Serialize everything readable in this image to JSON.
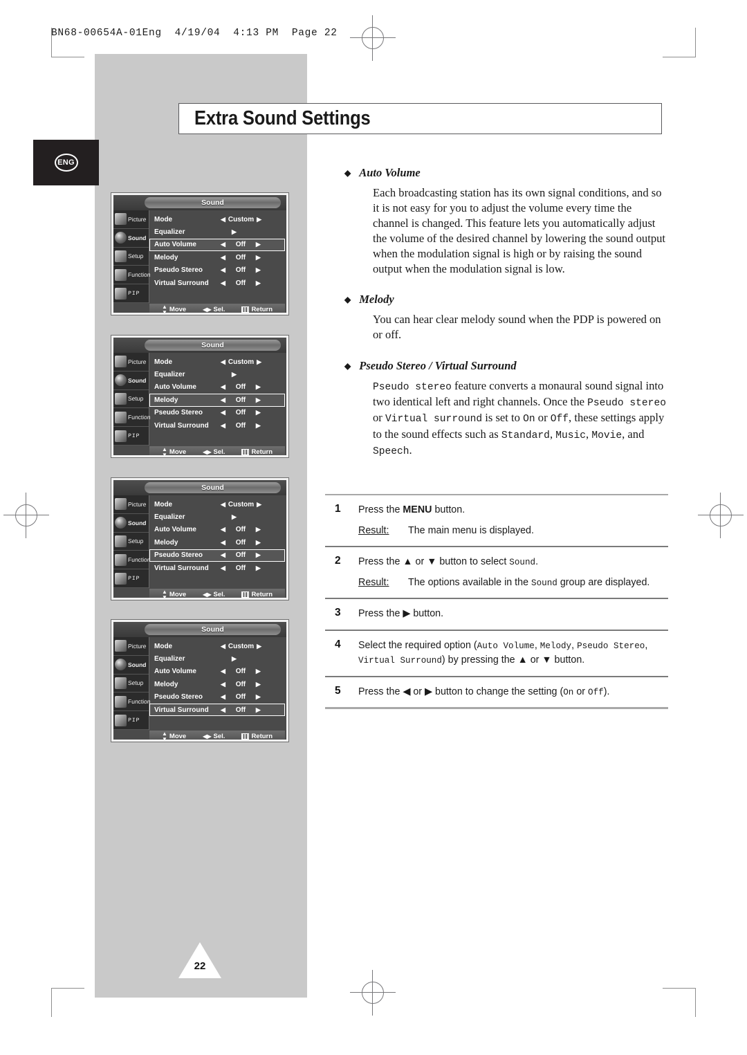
{
  "print_header": "BN68-00654A-01Eng  4/19/04  4:13 PM  Page 22",
  "language_badge": "ENG",
  "page_title": "Extra Sound Settings",
  "page_number": "22",
  "osd": {
    "title": "Sound",
    "sidebar": [
      {
        "label": "Picture",
        "icon": "picture-icon"
      },
      {
        "label": "Sound",
        "icon": "sound-icon"
      },
      {
        "label": "Setup",
        "icon": "setup-icon"
      },
      {
        "label": "Function",
        "icon": "function-icon"
      },
      {
        "label": "PIP",
        "icon": "pip-icon"
      }
    ],
    "rows": [
      {
        "label": "Mode",
        "value": "Custom",
        "arrows": "both"
      },
      {
        "label": "Equalizer",
        "value": "",
        "arrows": "right"
      },
      {
        "label": "Auto Volume",
        "value": "Off",
        "arrows": "both"
      },
      {
        "label": "Melody",
        "value": "Off",
        "arrows": "both"
      },
      {
        "label": "Pseudo Stereo",
        "value": "Off",
        "arrows": "both"
      },
      {
        "label": "Virtual Surround",
        "value": "Off",
        "arrows": "both"
      }
    ],
    "footer": [
      {
        "icon": "up-down-arrows-icon",
        "label": "Move"
      },
      {
        "icon": "left-right-arrows-icon",
        "label": "Sel."
      },
      {
        "icon": "menu-bars-icon",
        "label": "Return"
      }
    ],
    "screens": [
      {
        "highlight": "Auto Volume"
      },
      {
        "highlight": "Melody"
      },
      {
        "highlight": "Pseudo Stereo"
      },
      {
        "highlight": "Virtual Surround"
      }
    ]
  },
  "sections": [
    {
      "heading": "Auto Volume",
      "body": "Each broadcasting station has its own signal conditions, and so it is not easy for you to adjust the volume every time the channel is changed. This feature lets you automatically adjust the volume of the desired channel by lowering the sound output when the modulation signal is high or by raising the sound output when the modulation signal is low."
    },
    {
      "heading": "Melody",
      "body": "You can hear clear melody sound when the PDP is powered on or off."
    },
    {
      "heading": "Pseudo Stereo / Virtual Surround",
      "body_parts": [
        {
          "t": "Pseudo stereo",
          "m": true
        },
        {
          "t": " feature converts a monaural sound signal into two identical left and right channels. Once the ",
          "m": false
        },
        {
          "t": "Pseudo stereo",
          "m": true
        },
        {
          "t": " or ",
          "m": false
        },
        {
          "t": "Virtual surround",
          "m": true
        },
        {
          "t": " is set to ",
          "m": false
        },
        {
          "t": "On",
          "m": true
        },
        {
          "t": " or ",
          "m": false
        },
        {
          "t": "Off",
          "m": true
        },
        {
          "t": ", these settings apply to the sound effects such as ",
          "m": false
        },
        {
          "t": "Standard",
          "m": true
        },
        {
          "t": ", ",
          "m": false
        },
        {
          "t": "Music",
          "m": true
        },
        {
          "t": ", ",
          "m": false
        },
        {
          "t": "Movie",
          "m": true
        },
        {
          "t": ", and ",
          "m": false
        },
        {
          "t": "Speech",
          "m": true
        },
        {
          "t": ".",
          "m": false
        }
      ]
    }
  ],
  "steps": [
    {
      "num": "1",
      "parts": [
        {
          "t": "Press the ",
          "s": "n"
        },
        {
          "t": "MENU",
          "s": "b"
        },
        {
          "t": " button.",
          "s": "n"
        }
      ],
      "result_label": "Result:",
      "result_parts": [
        {
          "t": "The main menu is displayed.",
          "s": "n"
        }
      ]
    },
    {
      "num": "2",
      "parts": [
        {
          "t": "Press the ",
          "s": "n"
        },
        {
          "t": "▲",
          "s": "n"
        },
        {
          "t": " or ",
          "s": "n"
        },
        {
          "t": "▼",
          "s": "n"
        },
        {
          "t": " button to select ",
          "s": "n"
        },
        {
          "t": "Sound",
          "s": "m"
        },
        {
          "t": ".",
          "s": "n"
        }
      ],
      "result_label": "Result:",
      "result_parts": [
        {
          "t": "The options available in the ",
          "s": "n"
        },
        {
          "t": "Sound",
          "s": "m"
        },
        {
          "t": " group are displayed.",
          "s": "n"
        }
      ]
    },
    {
      "num": "3",
      "parts": [
        {
          "t": "Press the ",
          "s": "n"
        },
        {
          "t": "▶",
          "s": "n"
        },
        {
          "t": " button.",
          "s": "n"
        }
      ],
      "result_label": "",
      "result_parts": []
    },
    {
      "num": "4",
      "parts": [
        {
          "t": "Select the required option (",
          "s": "n"
        },
        {
          "t": "Auto Volume",
          "s": "m"
        },
        {
          "t": ", ",
          "s": "n"
        },
        {
          "t": "Melody",
          "s": "m"
        },
        {
          "t": ", ",
          "s": "n"
        },
        {
          "t": "Pseudo Stereo",
          "s": "m"
        },
        {
          "t": ", ",
          "s": "n"
        },
        {
          "t": "Virtual Surround",
          "s": "m"
        },
        {
          "t": ") by pressing the ",
          "s": "n"
        },
        {
          "t": "▲",
          "s": "n"
        },
        {
          "t": " or ",
          "s": "n"
        },
        {
          "t": "▼",
          "s": "n"
        },
        {
          "t": " button.",
          "s": "n"
        }
      ],
      "result_label": "",
      "result_parts": []
    },
    {
      "num": "5",
      "parts": [
        {
          "t": "Press the ",
          "s": "n"
        },
        {
          "t": "◀",
          "s": "n"
        },
        {
          "t": " or ",
          "s": "n"
        },
        {
          "t": "▶",
          "s": "n"
        },
        {
          "t": " button to change the setting (",
          "s": "n"
        },
        {
          "t": "On",
          "s": "m"
        },
        {
          "t": " or ",
          "s": "n"
        },
        {
          "t": "Off",
          "s": "m"
        },
        {
          "t": ").",
          "s": "n"
        }
      ],
      "result_label": "",
      "result_parts": []
    }
  ],
  "colors": {
    "band_gray": "#c9c9c9",
    "badge_dark": "#231f20",
    "osd_bg": "#4a4a4a",
    "text": "#1a1a1a"
  }
}
